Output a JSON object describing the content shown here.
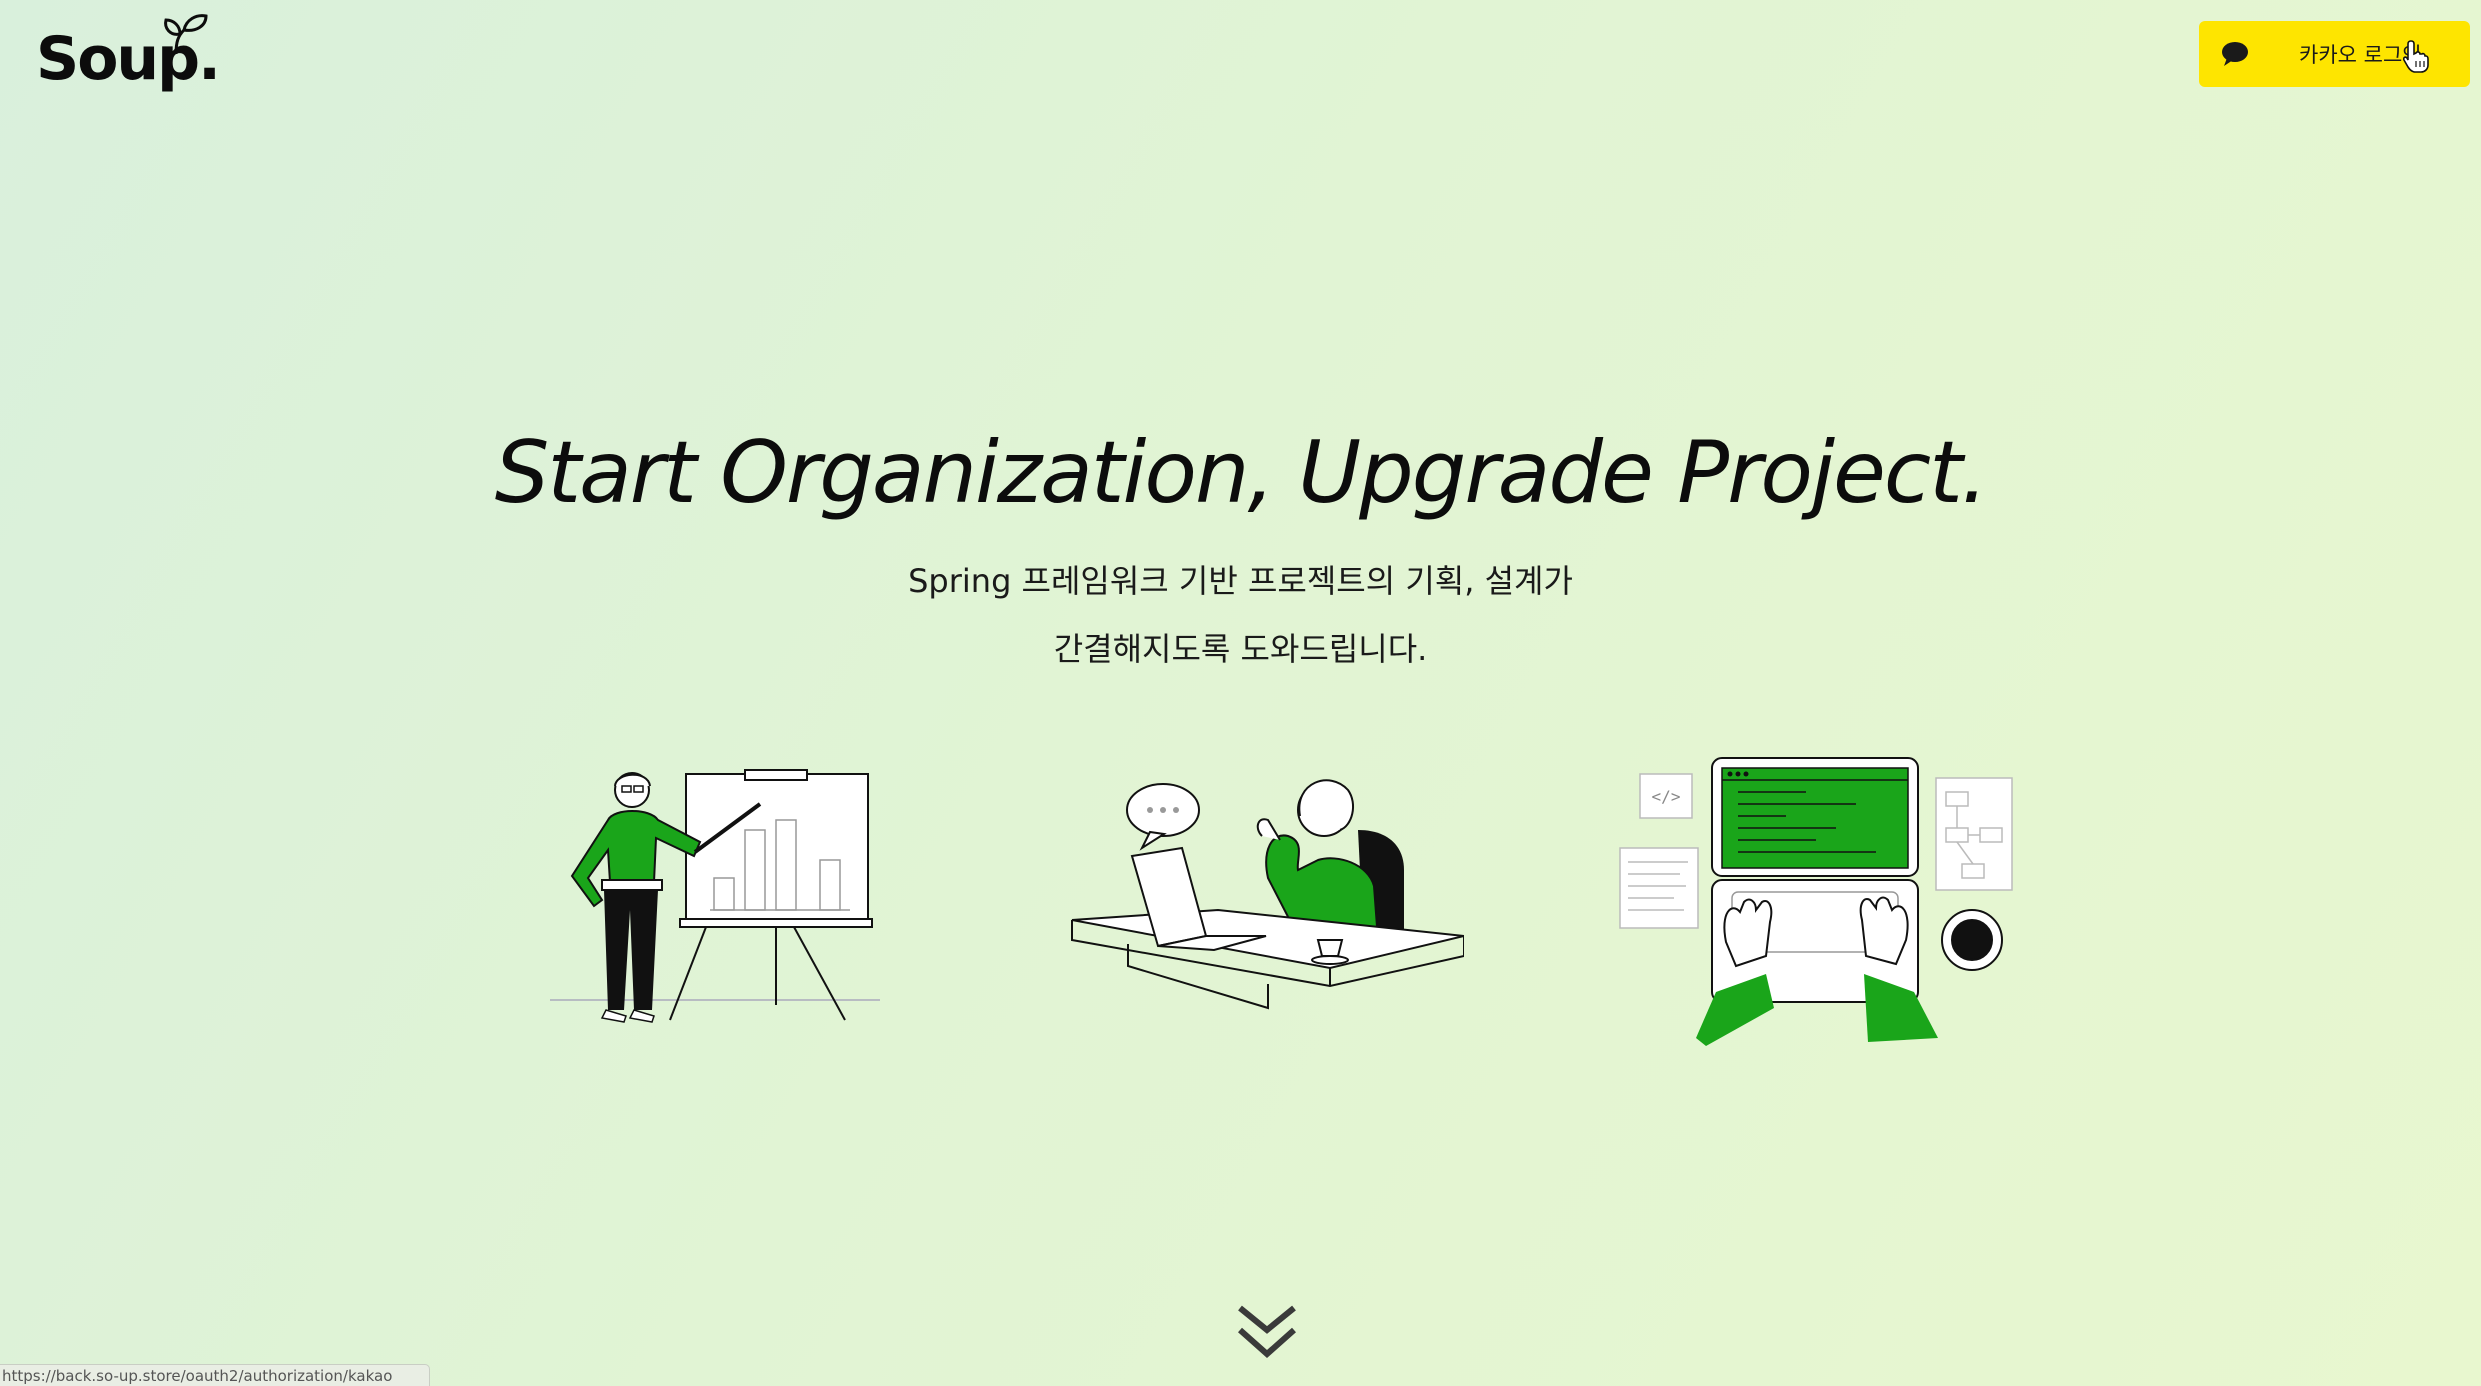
{
  "header": {
    "logo_text": "Soup.",
    "login_button": {
      "label": "카카오 로그인",
      "icon": "kakao-chat-icon",
      "color": "#fee500"
    }
  },
  "hero": {
    "title": "Start Organization, Upgrade Project.",
    "subtitle_line1": "Spring 프레임워크 기반 프로젝트의 기획, 설계가",
    "subtitle_line2": "간결해지도록 도와드립니다."
  },
  "illustrations": [
    {
      "name": "presenter-illustration"
    },
    {
      "name": "consultant-illustration"
    },
    {
      "name": "coder-illustration"
    }
  ],
  "scroll_indicator": {
    "icon": "double-chevron-down-icon"
  },
  "status_bar": {
    "url": "https://back.so-up.store/oauth2/authorization/kakao"
  },
  "colors": {
    "accent_green": "#1aa51a",
    "kakao_yellow": "#fee500",
    "background": "#e1f4d4"
  }
}
